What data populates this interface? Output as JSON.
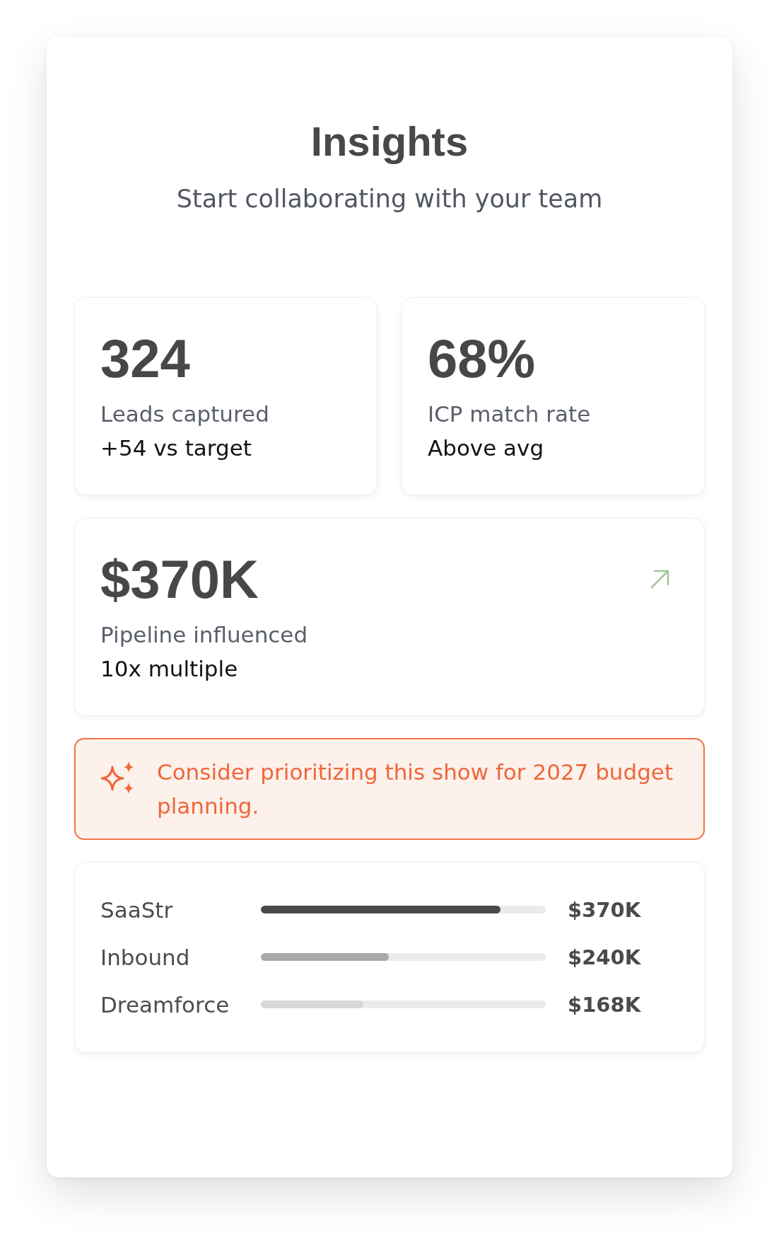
{
  "header": {
    "title": "Insights",
    "subtitle": "Start collaborating with your team"
  },
  "stats": [
    {
      "value": "324",
      "label": "Leads captured",
      "note": "+54 vs target"
    },
    {
      "value": "68%",
      "label": "ICP match rate",
      "note": "Above avg"
    }
  ],
  "pipeline": {
    "value": "$370K",
    "label": "Pipeline influenced",
    "note": "10x multiple"
  },
  "tip": {
    "text": "Consider prioritizing this show for 2027 budget planning."
  },
  "shows": [
    {
      "name": "SaaStr",
      "level": 0.84,
      "color": "#4a4a4a",
      "amount": "$370K"
    },
    {
      "name": "Inbound",
      "level": 0.45,
      "color": "#a9a9ab",
      "amount": "$240K"
    },
    {
      "name": "Dreamforce",
      "level": 0.36,
      "color": "#d7d7d9",
      "amount": "$168K"
    }
  ]
}
